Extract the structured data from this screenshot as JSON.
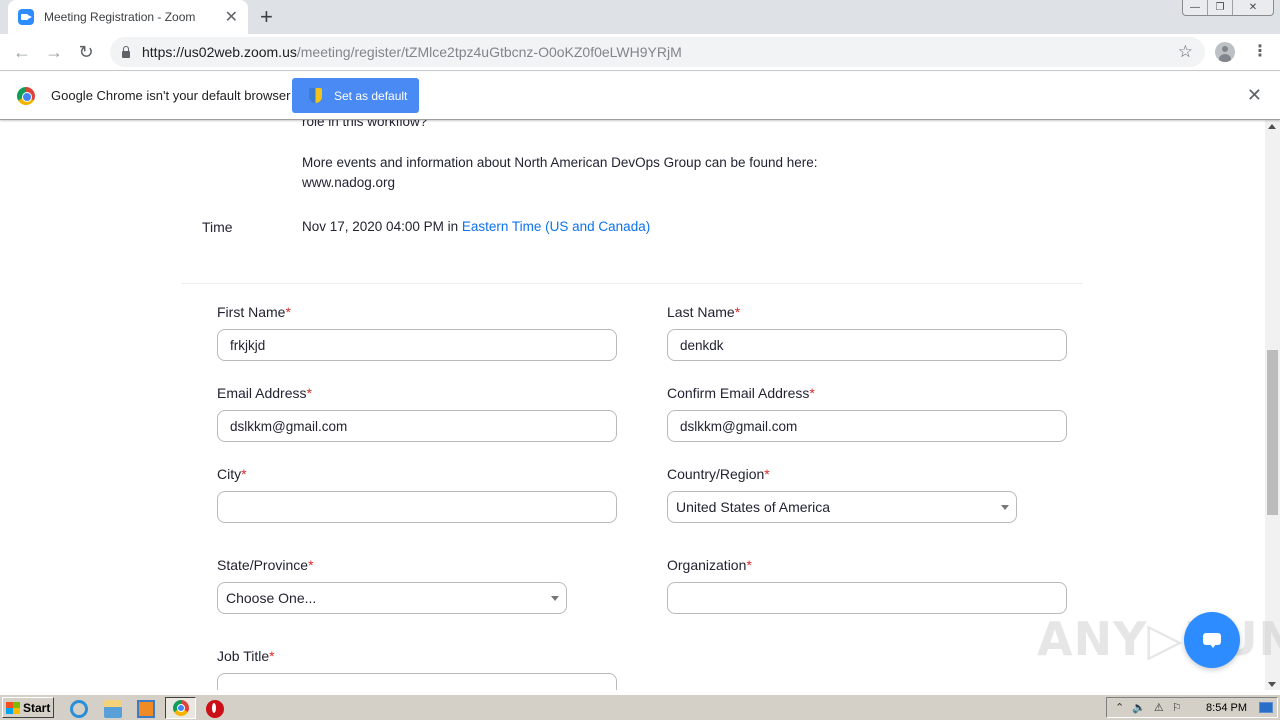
{
  "browser": {
    "tab": {
      "title": "Meeting Registration - Zoom",
      "favicon": "zoom-icon"
    },
    "new_tab_symbol": "+",
    "window_controls": {
      "minimize": "—",
      "restore": "❐",
      "close": "✕"
    },
    "url": {
      "host": "https://us02web.zoom.us",
      "path": "/meeting/register/tZMlce2tpz4uGtbcnz-O0oKZ0f0eLWH9YRjM"
    },
    "infobar": {
      "message": "Google Chrome isn't your default browser",
      "button_label": "Set as default"
    }
  },
  "meeting": {
    "description_tail": "role in this workflow?",
    "more_info": "More events and information about North American DevOps Group can be found here:",
    "website": "www.nadog.org",
    "time_label": "Time",
    "time_value": "Nov 17, 2020 04:00 PM in ",
    "timezone": "Eastern Time (US and Canada)"
  },
  "form": {
    "required_marker": "*",
    "first_name": {
      "label": "First Name",
      "value": "frkjkjd"
    },
    "last_name": {
      "label": "Last Name",
      "value": "denkdk"
    },
    "email": {
      "label": "Email Address",
      "value": "dslkkm@gmail.com"
    },
    "confirm_email": {
      "label": "Confirm Email Address",
      "value": "dslkkm@gmail.com"
    },
    "city": {
      "label": "City",
      "value": ""
    },
    "country": {
      "label": "Country/Region",
      "value": "United States of America"
    },
    "state": {
      "label": "State/Province",
      "value": "Choose One..."
    },
    "organization": {
      "label": "Organization",
      "value": ""
    },
    "job_title": {
      "label": "Job Title",
      "value": ""
    }
  },
  "watermark": "ANY▷RUN",
  "taskbar": {
    "start_label": "Start",
    "clock": "8:54 PM"
  },
  "colors": {
    "accent": "#2d8cff",
    "link": "#0e72ed",
    "required": "#e02828",
    "infobar_button": "#4a8af4"
  }
}
